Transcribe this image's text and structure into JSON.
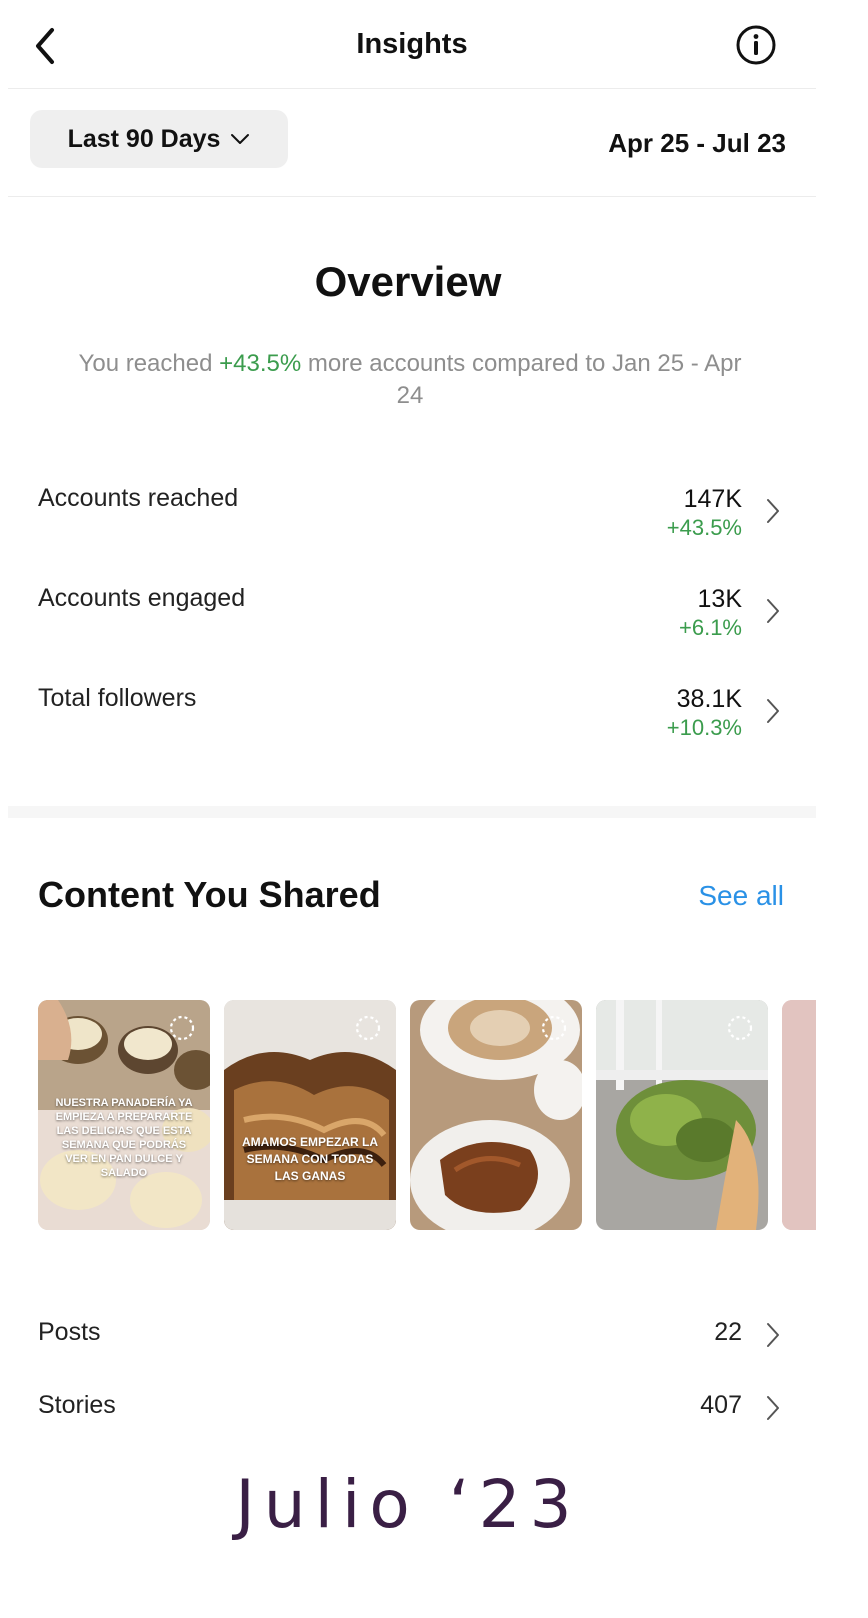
{
  "header": {
    "title": "Insights",
    "back_icon": "chevron-left-icon",
    "info_icon": "info-icon"
  },
  "filter": {
    "period": "Last 90 Days",
    "date_range": "Apr 25 - Jul 23"
  },
  "overview": {
    "title": "Overview",
    "desc_prefix": "You reached ",
    "desc_highlight": "+43.5%",
    "desc_suffix": " more accounts compared to Jan 25 - Apr 24",
    "metrics": [
      {
        "label": "Accounts reached",
        "value": "147K",
        "change": "+43.5%"
      },
      {
        "label": "Accounts engaged",
        "value": "13K",
        "change": "+6.1%"
      },
      {
        "label": "Total followers",
        "value": "38.1K",
        "change": "+10.3%"
      }
    ]
  },
  "content": {
    "title": "Content You Shared",
    "see_all": "See all",
    "thumbnails": [
      {
        "caption": "NUESTRA PANADERÍA YA EMPIEZA A PREPARARTE LAS DELICIAS QUE ESTA SEMANA QUE PODRÁS VER EN PAN DULCE Y SALADO"
      },
      {
        "caption": "AMAMOS EMPEZAR LA SEMANA CON TODAS LAS GANAS"
      },
      {
        "caption": ""
      },
      {
        "caption": ""
      },
      {
        "caption": ""
      }
    ],
    "counts": [
      {
        "label": "Posts",
        "value": "22"
      },
      {
        "label": "Stories",
        "value": "407"
      }
    ]
  },
  "footer": {
    "title": "Julio ‘23"
  },
  "colors": {
    "positive": "#3b9c4d",
    "link": "#2a91e6",
    "footer_text": "#3a1f45",
    "secondary_text": "#8e8e8e"
  }
}
